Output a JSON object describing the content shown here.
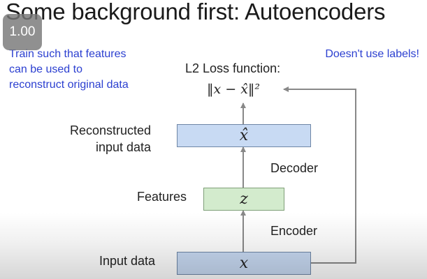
{
  "video": {
    "speed_badge": "1.00"
  },
  "slide": {
    "title": "Some background first: Autoencoders",
    "note_left": [
      "Train such that features",
      "can be used to",
      "reconstruct original data"
    ],
    "note_right": "Doesn't use labels!",
    "loss_label": "L2 Loss function:",
    "loss_formula": "‖x − x̂‖²",
    "labels": {
      "reconstructed": [
        "Reconstructed",
        "input data"
      ],
      "features": "Features",
      "input": "Input data",
      "decoder": "Decoder",
      "encoder": "Encoder"
    },
    "boxes": {
      "reconstructed": "x̂",
      "features": "z",
      "input": "x"
    }
  },
  "colors": {
    "note_text": "#2b3fd0",
    "box_blue": "#c8daf3",
    "box_green": "#d3ebcd",
    "arrow": "#888888"
  }
}
